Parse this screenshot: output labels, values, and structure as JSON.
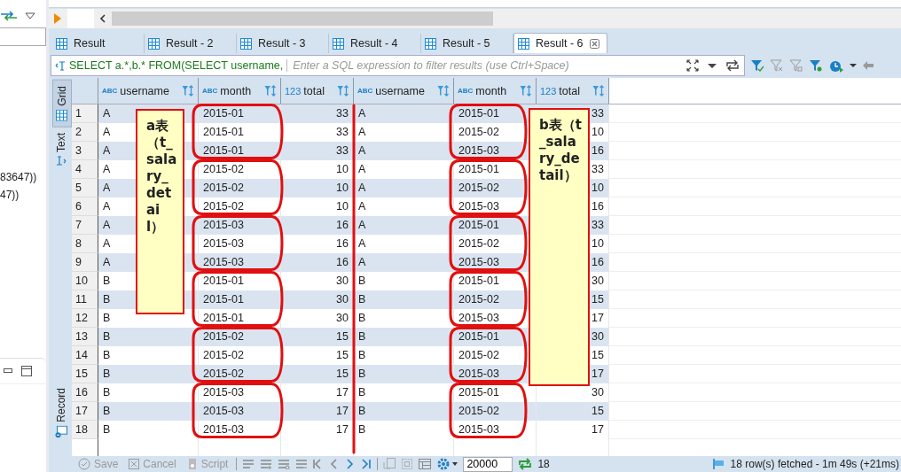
{
  "left_panel": {
    "lines": [
      "83647))",
      "47))"
    ]
  },
  "result_tabs": [
    {
      "label": "Result",
      "selected": false
    },
    {
      "label": "Result - 2",
      "selected": false
    },
    {
      "label": "Result - 3",
      "selected": false
    },
    {
      "label": "Result - 4",
      "selected": false
    },
    {
      "label": "Result - 5",
      "selected": false
    },
    {
      "label": "Result - 6",
      "selected": true
    }
  ],
  "filter_bar": {
    "query": "SELECT a.*,b.* FROM(SELECT username,",
    "placeholder": "Enter a SQL expression to filter results (use Ctrl+Space)"
  },
  "side_tabs": [
    {
      "label": "Grid",
      "selected": true
    },
    {
      "label": "Text",
      "selected": false
    },
    {
      "label": "Record",
      "selected": false
    }
  ],
  "table": {
    "columns": [
      {
        "type_label": "ABC",
        "name": "username",
        "kind": "text"
      },
      {
        "type_label": "ABC",
        "name": "month",
        "kind": "text"
      },
      {
        "type_label": "123",
        "name": "total",
        "kind": "number"
      },
      {
        "type_label": "ABC",
        "name": "username",
        "kind": "text"
      },
      {
        "type_label": "ABC",
        "name": "month",
        "kind": "text"
      },
      {
        "type_label": "123",
        "name": "total",
        "kind": "number"
      }
    ],
    "rows": [
      {
        "number": "1",
        "cells": [
          "A",
          "2015-01",
          "33",
          "A",
          "2015-01",
          "33"
        ]
      },
      {
        "number": "2",
        "cells": [
          "A",
          "2015-01",
          "33",
          "A",
          "2015-02",
          "10"
        ]
      },
      {
        "number": "3",
        "cells": [
          "A",
          "2015-01",
          "33",
          "A",
          "2015-03",
          "16"
        ]
      },
      {
        "number": "4",
        "cells": [
          "A",
          "2015-02",
          "10",
          "A",
          "2015-01",
          "33"
        ]
      },
      {
        "number": "5",
        "cells": [
          "A",
          "2015-02",
          "10",
          "A",
          "2015-02",
          "10"
        ]
      },
      {
        "number": "6",
        "cells": [
          "A",
          "2015-02",
          "10",
          "A",
          "2015-03",
          "16"
        ]
      },
      {
        "number": "7",
        "cells": [
          "A",
          "2015-03",
          "16",
          "A",
          "2015-01",
          "33"
        ]
      },
      {
        "number": "8",
        "cells": [
          "A",
          "2015-03",
          "16",
          "A",
          "2015-02",
          "10"
        ]
      },
      {
        "number": "9",
        "cells": [
          "A",
          "2015-03",
          "16",
          "A",
          "2015-03",
          "16"
        ]
      },
      {
        "number": "10",
        "cells": [
          "B",
          "2015-01",
          "30",
          "B",
          "2015-01",
          "30"
        ]
      },
      {
        "number": "11",
        "cells": [
          "B",
          "2015-01",
          "30",
          "B",
          "2015-02",
          "15"
        ]
      },
      {
        "number": "12",
        "cells": [
          "B",
          "2015-01",
          "30",
          "B",
          "2015-03",
          "17"
        ]
      },
      {
        "number": "13",
        "cells": [
          "B",
          "2015-02",
          "15",
          "B",
          "2015-01",
          "30"
        ]
      },
      {
        "number": "14",
        "cells": [
          "B",
          "2015-02",
          "15",
          "B",
          "2015-02",
          "15"
        ]
      },
      {
        "number": "15",
        "cells": [
          "B",
          "2015-02",
          "15",
          "B",
          "2015-03",
          "17"
        ]
      },
      {
        "number": "16",
        "cells": [
          "B",
          "2015-03",
          "17",
          "B",
          "2015-01",
          "30"
        ]
      },
      {
        "number": "17",
        "cells": [
          "B",
          "2015-03",
          "17",
          "B",
          "2015-02",
          "15"
        ]
      },
      {
        "number": "18",
        "cells": [
          "B",
          "2015-03",
          "17",
          "B",
          "2015-03",
          "17"
        ]
      }
    ]
  },
  "notes": [
    {
      "text": "a表（t_salary_detail）"
    },
    {
      "text": "b表（t_salary_detail）"
    }
  ],
  "bottom_bar": {
    "buttons": [
      {
        "label": "Save",
        "disabled": true
      },
      {
        "label": "Cancel",
        "disabled": true
      },
      {
        "label": "Script",
        "disabled": true
      }
    ],
    "fetch_size": "20000",
    "count": "18",
    "status": "18 row(s) fetched - 1m 49s (+21ms)"
  }
}
